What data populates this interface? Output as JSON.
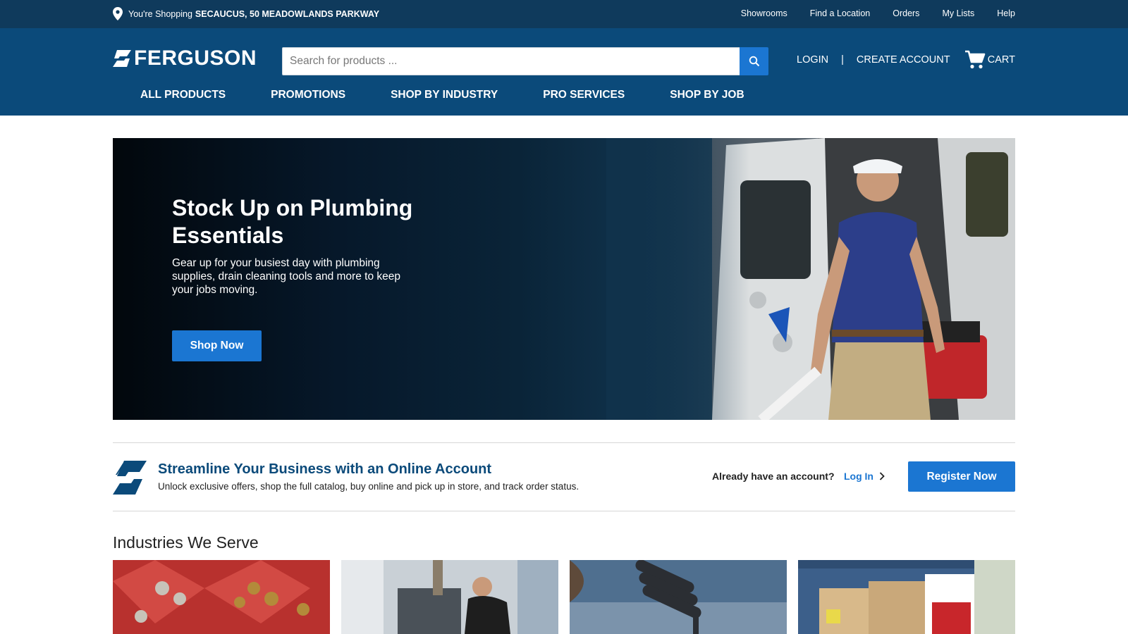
{
  "utility": {
    "shopping_prefix": "You're Shopping",
    "store": "SECAUCUS, 50 MEADOWLANDS PARKWAY",
    "links": [
      "Showrooms",
      "Find a Location",
      "Orders",
      "My Lists",
      "Help"
    ]
  },
  "header": {
    "logo_text": "FERGUSON",
    "search_placeholder": "Search for products ...",
    "login": "LOGIN",
    "separator": "|",
    "create_account": "CREATE ACCOUNT",
    "cart": "CART"
  },
  "nav": [
    "ALL PRODUCTS",
    "PROMOTIONS",
    "SHOP BY INDUSTRY",
    "PRO SERVICES",
    "SHOP BY JOB"
  ],
  "hero": {
    "title": "Stock Up on Plumbing Essentials",
    "body": "Gear up for your busiest day with plumbing supplies, drain cleaning tools and more to keep your jobs moving.",
    "cta": "Shop Now"
  },
  "account_banner": {
    "title": "Streamline Your Business with an Online Account",
    "subtitle": "Unlock exclusive offers, shop the full catalog, buy online and pick up in store, and track order status.",
    "already": "Already have an account?",
    "login": "Log In",
    "register": "Register Now"
  },
  "industries": {
    "title": "Industries We Serve"
  },
  "colors": {
    "utility_bg": "#0f3a5c",
    "header_bg": "#0b4a7a",
    "accent": "#1b76d2"
  }
}
